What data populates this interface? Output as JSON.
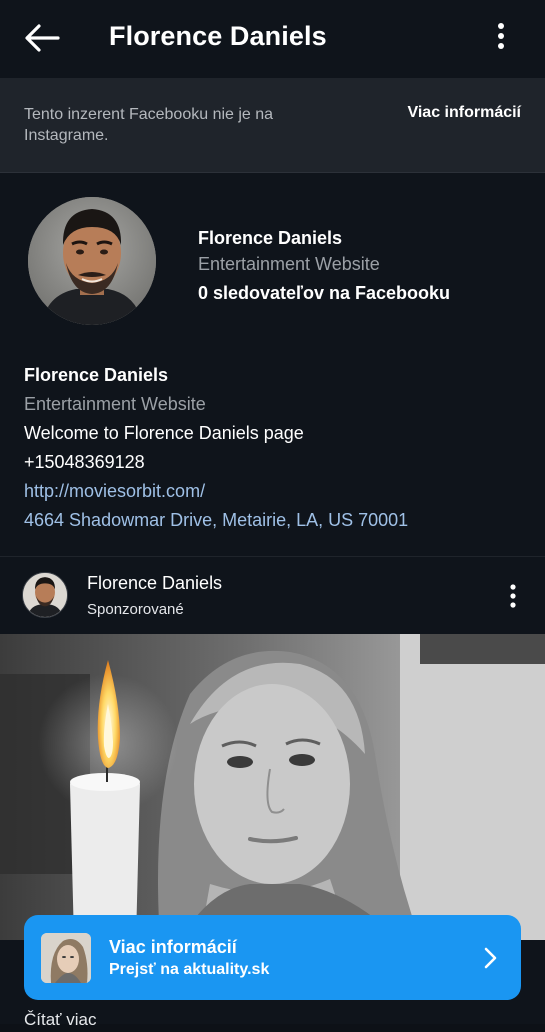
{
  "header": {
    "title": "Florence Daniels",
    "back_icon": "arrow-left-icon",
    "more_icon": "more-vertical-icon"
  },
  "notice": {
    "text": "Tento inzerent Facebooku nie je na Instagrame.",
    "link": "Viac informácií"
  },
  "profile": {
    "name": "Florence Daniels",
    "category": "Entertainment Website",
    "followers": "0 sledovateľov na Facebooku"
  },
  "bio": {
    "name": "Florence Daniels",
    "category": "Entertainment Website",
    "description": "Welcome to Florence Daniels page",
    "phone": "+15048369128",
    "website": "http://moviesorbit.com/",
    "address": "4664 Shadowmar Drive, Metairie, LA, US 70001"
  },
  "post": {
    "author": "Florence Daniels",
    "sponsored_label": "Sponzorované",
    "more_icon": "more-vertical-icon"
  },
  "cta": {
    "title": "Viac informácií",
    "subtitle": "Prejsť na aktuality.sk",
    "chevron_icon": "chevron-right-icon",
    "color": "#1a96f2"
  },
  "footer": {
    "read_more": "Čítať viac"
  },
  "colors": {
    "background": "#0f141b",
    "notice_background": "#1f242b",
    "muted_text": "#9ba0a6",
    "link_text": "#9fc0e6"
  }
}
